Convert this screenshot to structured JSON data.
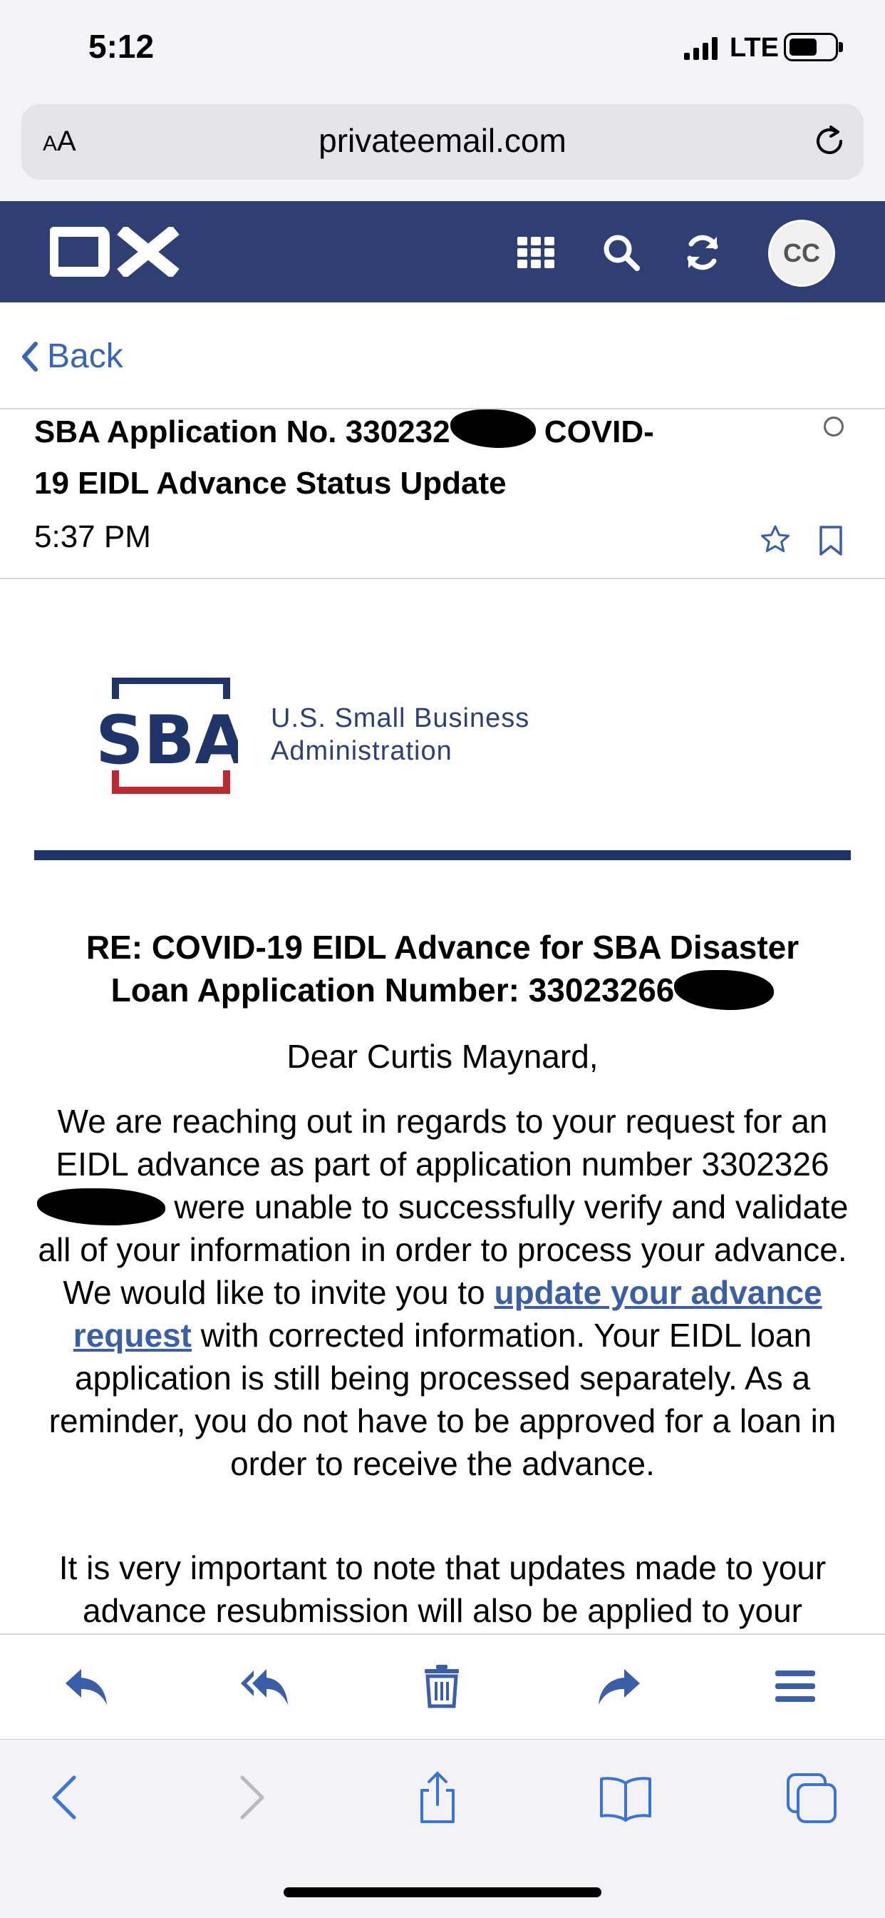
{
  "status_bar": {
    "time": "5:12",
    "network": "LTE"
  },
  "browser": {
    "text_size_label_small": "A",
    "text_size_label_large": "A",
    "url": "privateemail.com"
  },
  "app": {
    "logo_text": "OX",
    "avatar_initials": "CC"
  },
  "nav": {
    "back_label": "Back"
  },
  "email": {
    "subject_part1": "SBA Application No. 330232",
    "subject_part2": "COVID-",
    "subject_part3": "19 EIDL Advance Status Update",
    "time": "5:37 PM"
  },
  "sba": {
    "logo_text": "SBA",
    "name_line1": "U.S. Small Business",
    "name_line2": "Administration",
    "colors": {
      "navy": "#1f3468",
      "red": "#c0282d"
    }
  },
  "body": {
    "re_line1": "RE: COVID-19 EIDL Advance for SBA Disaster",
    "re_line2": "Loan Application Number: 33023266",
    "greeting": "Dear Curtis Maynard,",
    "p1_a": "We are reaching out in regards to your request for an EIDL advance as part of application number 3302326",
    "p1_b": " were unable to successfully verify and validate all of your information in order to process your advance. We would like to invite you to ",
    "p1_link": "update your advance request",
    "p1_c": " with corrected information. Your EIDL loan application is still being processed separately. As a reminder, you do not have to be approved for a loan in order to receive the advance.",
    "p2": "It is very important to note that updates made to your advance resubmission will also be applied to your"
  },
  "toolbar_icons": [
    "reply-icon",
    "reply-all-icon",
    "trash-icon",
    "forward-icon",
    "menu-icon"
  ],
  "safari_icons": [
    "back-icon",
    "forward-icon",
    "share-icon",
    "bookmarks-icon",
    "tabs-icon"
  ],
  "accent_color": "#3a65b5",
  "header_color": "#2e4073"
}
